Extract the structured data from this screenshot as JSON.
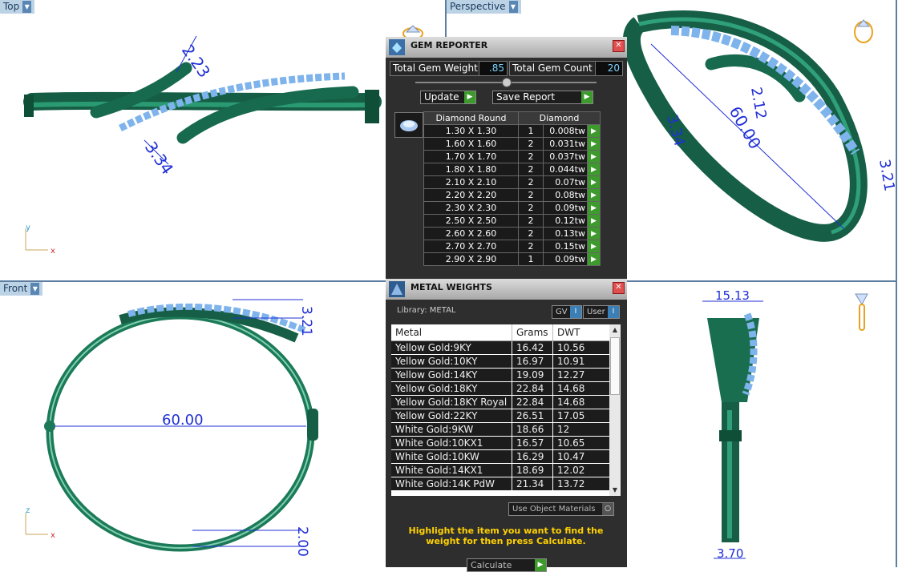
{
  "viewports": {
    "top": {
      "label": "Top"
    },
    "perspective": {
      "label": "Perspective"
    },
    "front": {
      "label": "Front"
    }
  },
  "axes": {
    "y": "y",
    "x": "x",
    "z": "z"
  },
  "dimensions": {
    "top_a": "2.23",
    "top_b": "3.34",
    "front_width": "60.00",
    "front_height": "3.21",
    "front_bottom": "2.00",
    "side_width": "15.13",
    "side_bottom": "3.70",
    "persp_a": "60.00",
    "persp_b": "2.12",
    "persp_c": "3.21",
    "persp_d": "3.34"
  },
  "gem_reporter": {
    "title": "GEM REPORTER",
    "total_weight_label": "Total Gem Weight",
    "total_weight_value": ".85",
    "total_count_label": "Total Gem Count",
    "total_count_value": "20",
    "update_label": "Update",
    "save_label": "Save Report",
    "col_shape": "Diamond Round",
    "col_material": "Diamond",
    "rows": [
      {
        "size": "1.30 X 1.30",
        "qty": "1",
        "tw": "0.008tw"
      },
      {
        "size": "1.60 X 1.60",
        "qty": "2",
        "tw": "0.031tw"
      },
      {
        "size": "1.70 X 1.70",
        "qty": "2",
        "tw": "0.037tw"
      },
      {
        "size": "1.80 X 1.80",
        "qty": "2",
        "tw": "0.044tw"
      },
      {
        "size": "2.10 X 2.10",
        "qty": "2",
        "tw": "0.07tw"
      },
      {
        "size": "2.20 X 2.20",
        "qty": "2",
        "tw": "0.08tw"
      },
      {
        "size": "2.30 X 2.30",
        "qty": "2",
        "tw": "0.09tw"
      },
      {
        "size": "2.50 X 2.50",
        "qty": "2",
        "tw": "0.12tw"
      },
      {
        "size": "2.60 X 2.60",
        "qty": "2",
        "tw": "0.13tw"
      },
      {
        "size": "2.70 X 2.70",
        "qty": "2",
        "tw": "0.15tw"
      },
      {
        "size": "2.90 X 2.90",
        "qty": "1",
        "tw": "0.09tw"
      }
    ]
  },
  "metal_weights": {
    "title": "METAL WEIGHTS",
    "library": "Library: METAL",
    "gv_label": "GV",
    "user_label": "User",
    "col_metal": "Metal",
    "col_grams": "Grams",
    "col_dwt": "DWT",
    "rows": [
      {
        "metal": "Yellow Gold:9KY",
        "grams": "16.42",
        "dwt": "10.56"
      },
      {
        "metal": "Yellow Gold:10KY",
        "grams": "16.97",
        "dwt": "10.91"
      },
      {
        "metal": "Yellow Gold:14KY",
        "grams": "19.09",
        "dwt": "12.27"
      },
      {
        "metal": "Yellow Gold:18KY",
        "grams": "22.84",
        "dwt": "14.68"
      },
      {
        "metal": "Yellow Gold:18KY Royal",
        "grams": "22.84",
        "dwt": "14.68"
      },
      {
        "metal": "Yellow Gold:22KY",
        "grams": "26.51",
        "dwt": "17.05"
      },
      {
        "metal": "White Gold:9KW",
        "grams": "18.66",
        "dwt": "12"
      },
      {
        "metal": "White Gold:10KX1",
        "grams": "16.57",
        "dwt": "10.65"
      },
      {
        "metal": "White Gold:10KW",
        "grams": "16.29",
        "dwt": "10.47"
      },
      {
        "metal": "White Gold:14KX1",
        "grams": "18.69",
        "dwt": "12.02"
      },
      {
        "metal": "White Gold:14K PdW",
        "grams": "21.34",
        "dwt": "13.72"
      }
    ],
    "use_object_materials": "Use Object Materials",
    "hint": "Highlight the item you want to find the weight for then press Calculate.",
    "calculate_label": "Calculate"
  },
  "colors": {
    "metal_green": "#1b7a58",
    "gem_blue": "#7eb3ec",
    "dim_blue": "#1f2fd6",
    "accent_green": "#3d9a2c"
  }
}
